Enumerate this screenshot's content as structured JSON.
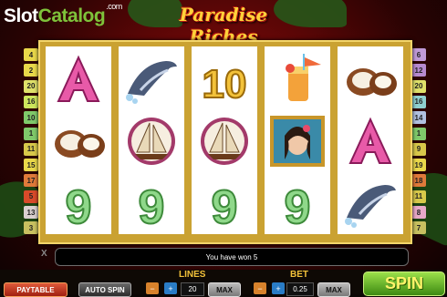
{
  "logo": {
    "slot": "Slot",
    "catalog": "Catalog",
    "com": ".com"
  },
  "game_title": "Paradise Riches",
  "lines_left": [
    {
      "label": "4",
      "color": "#e9d84a"
    },
    {
      "label": "2",
      "color": "#e9d84a"
    },
    {
      "label": "20",
      "color": "#dfe16a"
    },
    {
      "label": "16",
      "color": "#cde65c"
    },
    {
      "label": "10",
      "color": "#7fc96a"
    },
    {
      "label": "1",
      "color": "#7fc96a"
    },
    {
      "label": "11",
      "color": "#d8c84a"
    },
    {
      "label": "15",
      "color": "#e9d84a"
    },
    {
      "label": "17",
      "color": "#e07a3a"
    },
    {
      "label": "5",
      "color": "#d84a2a"
    },
    {
      "label": "13",
      "color": "#dad0d0"
    },
    {
      "label": "3",
      "color": "#c8c060"
    }
  ],
  "lines_right": [
    {
      "label": "6",
      "color": "#c09ad8"
    },
    {
      "label": "12",
      "color": "#b78ad0"
    },
    {
      "label": "20",
      "color": "#dfe16a"
    },
    {
      "label": "16",
      "color": "#8fd0d0"
    },
    {
      "label": "14",
      "color": "#b0c0e0"
    },
    {
      "label": "1",
      "color": "#7fc96a"
    },
    {
      "label": "9",
      "color": "#d8c84a"
    },
    {
      "label": "19",
      "color": "#e9d84a"
    },
    {
      "label": "18",
      "color": "#e07a3a"
    },
    {
      "label": "11",
      "color": "#d8c84a"
    },
    {
      "label": "8",
      "color": "#e8a8c8"
    },
    {
      "label": "7",
      "color": "#c8c060"
    }
  ],
  "reels": [
    [
      "A",
      "coconut",
      "9"
    ],
    [
      "dolphin",
      "sailboat",
      "9"
    ],
    [
      "10",
      "sailboat",
      "9"
    ],
    [
      "cocktail",
      "girl",
      "9"
    ],
    [
      "coconut",
      "A",
      "dolphin"
    ]
  ],
  "win_message": "You have won  5",
  "controls": {
    "paytable": "PAYTABLE",
    "auto_spin": "AUTO SPIN",
    "lines_label": "LINES",
    "lines_value": "20",
    "lines_max": "MAX",
    "bet_label": "BET",
    "bet_value": "0.25",
    "bet_max": "MAX",
    "spin": "SPIN",
    "minus": "−",
    "plus": "+"
  },
  "close_glyph": "X"
}
